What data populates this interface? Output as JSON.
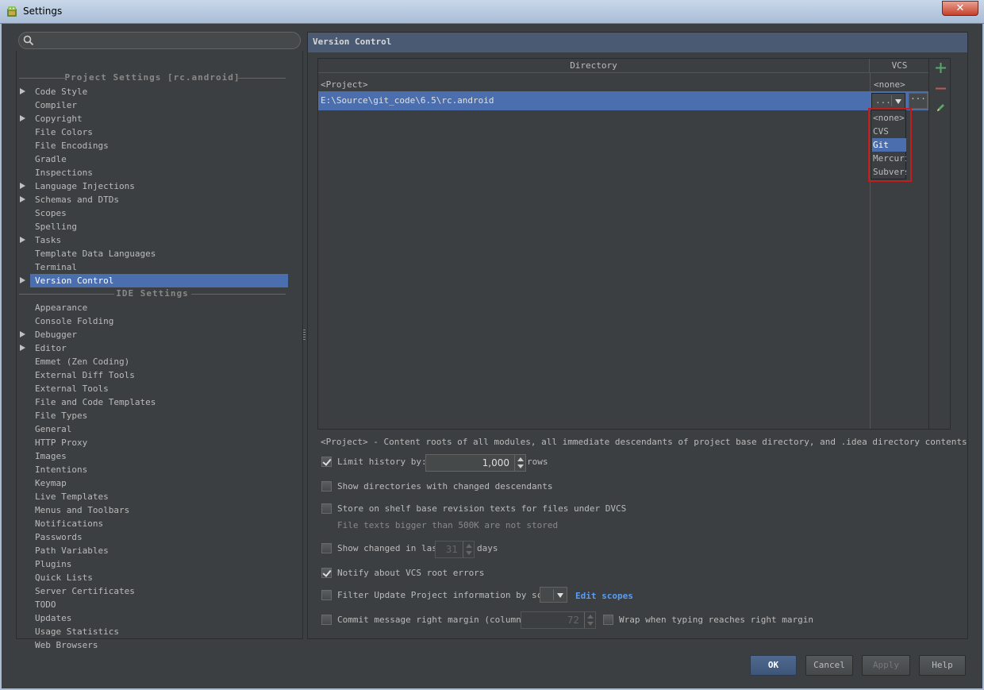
{
  "window": {
    "title": "Settings",
    "close_label": "✕"
  },
  "search": {
    "placeholder": ""
  },
  "tree": {
    "project_header": "Project Settings [rc.android]",
    "project_items": [
      {
        "label": "Code Style",
        "arrow": true
      },
      {
        "label": "Compiler",
        "arrow": false
      },
      {
        "label": "Copyright",
        "arrow": true
      },
      {
        "label": "File Colors",
        "arrow": false
      },
      {
        "label": "File Encodings",
        "arrow": false
      },
      {
        "label": "Gradle",
        "arrow": false
      },
      {
        "label": "Inspections",
        "arrow": false
      },
      {
        "label": "Language Injections",
        "arrow": true
      },
      {
        "label": "Schemas and DTDs",
        "arrow": true
      },
      {
        "label": "Scopes",
        "arrow": false
      },
      {
        "label": "Spelling",
        "arrow": false
      },
      {
        "label": "Tasks",
        "arrow": true
      },
      {
        "label": "Template Data Languages",
        "arrow": false
      },
      {
        "label": "Terminal",
        "arrow": false
      },
      {
        "label": "Version Control",
        "arrow": true,
        "selected": true
      }
    ],
    "ide_header": "IDE Settings",
    "ide_items": [
      {
        "label": "Appearance",
        "arrow": false
      },
      {
        "label": "Console Folding",
        "arrow": false
      },
      {
        "label": "Debugger",
        "arrow": true
      },
      {
        "label": "Editor",
        "arrow": true
      },
      {
        "label": "Emmet (Zen Coding)",
        "arrow": false
      },
      {
        "label": "External Diff Tools",
        "arrow": false
      },
      {
        "label": "External Tools",
        "arrow": false
      },
      {
        "label": "File and Code Templates",
        "arrow": false
      },
      {
        "label": "File Types",
        "arrow": false
      },
      {
        "label": "General",
        "arrow": false
      },
      {
        "label": "HTTP Proxy",
        "arrow": false
      },
      {
        "label": "Images",
        "arrow": false
      },
      {
        "label": "Intentions",
        "arrow": false
      },
      {
        "label": "Keymap",
        "arrow": false
      },
      {
        "label": "Live Templates",
        "arrow": false
      },
      {
        "label": "Menus and Toolbars",
        "arrow": false
      },
      {
        "label": "Notifications",
        "arrow": false
      },
      {
        "label": "Passwords",
        "arrow": false
      },
      {
        "label": "Path Variables",
        "arrow": false
      },
      {
        "label": "Plugins",
        "arrow": false
      },
      {
        "label": "Quick Lists",
        "arrow": false
      },
      {
        "label": "Server Certificates",
        "arrow": false
      },
      {
        "label": "TODO",
        "arrow": false
      },
      {
        "label": "Updates",
        "arrow": false
      },
      {
        "label": "Usage Statistics",
        "arrow": false
      },
      {
        "label": "Web Browsers",
        "arrow": false
      }
    ]
  },
  "panel": {
    "title": "Version Control",
    "table": {
      "col_directory": "Directory",
      "col_vcs": "VCS",
      "rows": [
        {
          "dir": "<Project>",
          "vcs": "<none>"
        },
        {
          "dir": "E:\\Source\\git_code\\6.5\\rc.android",
          "vcs": "..."
        }
      ],
      "more_label": "···"
    },
    "dropdown": {
      "options": [
        "<none>",
        "CVS",
        "Git",
        "Mercurial",
        "Subversion"
      ],
      "selected": "Git"
    },
    "note": "<Project> - Content roots of all modules, all immediate descendants of project base directory, and .idea directory contents",
    "limit_history": {
      "label": "Limit history by:",
      "value": "1,000",
      "suffix": "rows",
      "checked": true
    },
    "show_dirs": {
      "label": "Show directories with changed descendants",
      "checked": false
    },
    "store_shelf": {
      "label": "Store on shelf base revision texts for files under DVCS",
      "checked": false,
      "note": "File texts bigger than 500K are not stored"
    },
    "show_changed": {
      "label": "Show changed in last",
      "value": "31",
      "suffix": "days",
      "checked": false
    },
    "notify_root": {
      "label": "Notify about VCS root errors",
      "checked": true
    },
    "filter_update": {
      "label": "Filter Update Project information by scope",
      "link": "Edit scopes",
      "checked": false
    },
    "commit_margin": {
      "label": "Commit message right margin (columns):",
      "value": "72",
      "checked": false
    },
    "wrap": {
      "label": "Wrap when typing reaches right margin",
      "checked": false
    }
  },
  "buttons": {
    "ok": "OK",
    "cancel": "Cancel",
    "apply": "Apply",
    "help": "Help"
  },
  "colors": {
    "selection": "#4b6eaf",
    "background": "#3c3f41",
    "link": "#589df6",
    "highlight_outline": "#c21c1c"
  }
}
